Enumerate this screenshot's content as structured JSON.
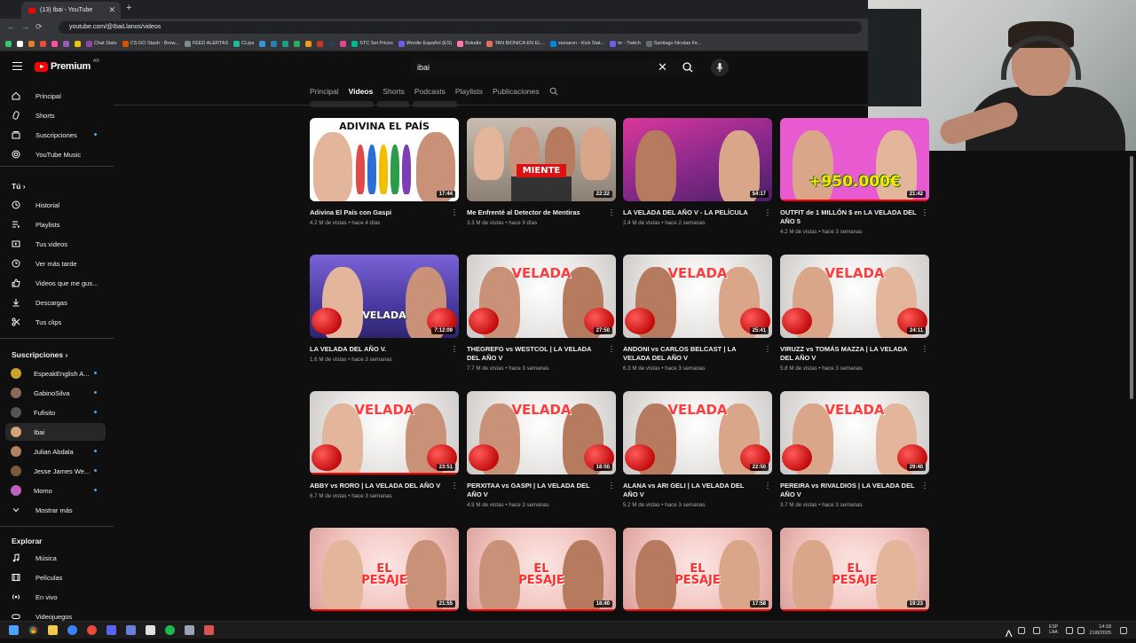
{
  "browser": {
    "tab_title": "(13) Ibai - YouTube",
    "url": "youtube.com/@IbaiLlanos/videos",
    "bookmarks": [
      "",
      "",
      "",
      "",
      "",
      "",
      "",
      "Chat Stats",
      "CS:GO Stash - Brow...",
      "FEED ALERTAS",
      "CLips",
      "",
      "",
      "",
      "",
      "",
      "",
      "",
      "",
      "STC Set Prices",
      "Wordle Español (ES)",
      "Boludle",
      "TAN BIONICA EN EL...",
      "sionaron - Kick Stat...",
      "trr - Twitch",
      "Santiago Nicolas Fe..."
    ]
  },
  "masthead": {
    "logo_text": "Premium",
    "country_code": "AR",
    "search_value": "ibai"
  },
  "sidebar": {
    "main": [
      {
        "label": "Principal",
        "icon": "home-icon"
      },
      {
        "label": "Shorts",
        "icon": "shorts-icon"
      },
      {
        "label": "Suscripciones",
        "icon": "subscriptions-icon"
      },
      {
        "label": "YouTube Music",
        "icon": "music-icon"
      }
    ],
    "you_heading": "Tú",
    "you": [
      {
        "label": "Historial",
        "icon": "history-icon"
      },
      {
        "label": "Playlists",
        "icon": "playlists-icon"
      },
      {
        "label": "Tus videos",
        "icon": "your-videos-icon"
      },
      {
        "label": "Ver más tarde",
        "icon": "watch-later-icon"
      },
      {
        "label": "Videos que me gus...",
        "icon": "like-icon"
      },
      {
        "label": "Descargas",
        "icon": "download-icon"
      },
      {
        "label": "Tus clips",
        "icon": "clips-icon"
      }
    ],
    "subs_heading": "Suscripciones",
    "subs": [
      {
        "label": "EspeakEnglish A...",
        "color": "#c9a227"
      },
      {
        "label": "GabinoSilva",
        "color": "#8b6b5a"
      },
      {
        "label": "Fufisito",
        "color": "#555555"
      },
      {
        "label": "Ibai",
        "color": "#d4a37a"
      },
      {
        "label": "Julian Abdala",
        "color": "#b08060"
      },
      {
        "label": "Jesse James We...",
        "color": "#7a5a3a"
      },
      {
        "label": "Momo",
        "color": "#c060c0"
      }
    ],
    "show_more": "Mostrar más",
    "explore_heading": "Explorar",
    "explore": [
      {
        "label": "Música",
        "icon": "music-note-icon"
      },
      {
        "label": "Películas",
        "icon": "film-icon"
      },
      {
        "label": "En vivo",
        "icon": "live-icon"
      },
      {
        "label": "Videojuegos",
        "icon": "gaming-icon"
      }
    ]
  },
  "channel_tabs": [
    "Principal",
    "Videos",
    "Shorts",
    "Podcasts",
    "Playlists",
    "Publicaciones"
  ],
  "active_tab": "Videos",
  "videos": [
    {
      "title": "Adivina El País con Gaspi",
      "views": "4.2 M de vistas",
      "age": "hace 4 días",
      "duration": "17:44",
      "caption": "ADIVINA EL PAÍS",
      "caption_color": "#ffffff",
      "bg": "#ffffff",
      "watched": 0.0
    },
    {
      "title": "Me Enfrenté al Detector de Mentiras",
      "views": "3.3 M de vistas",
      "age": "hace 9 días",
      "duration": "22:22",
      "caption": "MIENTE",
      "caption_color": "#ffffff",
      "bg": "#b7a89a",
      "watched": 0.0
    },
    {
      "title": "LA VELADA DEL AÑO V - LA PELÍCULA",
      "views": "2.4 M de vistas",
      "age": "hace 2 semanas",
      "duration": "54:17",
      "caption": "",
      "caption_color": "#ffffff",
      "bg": "#b0307a",
      "watched": 0.0
    },
    {
      "title": "OUTFIT de 1 MILLÓN $ en LA VELADA DEL AÑO 5",
      "views": "4.2 M de vistas",
      "age": "hace 3 semanas",
      "duration": "21:42",
      "caption": "+950.000€",
      "caption_color": "#ffe600",
      "bg": "#e85bd0",
      "watched": 1.0
    },
    {
      "title": "LA VELADA DEL AÑO V.",
      "views": "1.6 M de vistas",
      "age": "hace 3 semanas",
      "duration": "7:12:09",
      "caption": "VELADA",
      "caption_color": "#ffffff",
      "bg": "#6a4fc8",
      "watched": 0.0
    },
    {
      "title": "THEGREFG vs WESTCOL | LA VELADA DEL AÑO V",
      "views": "7.7 M de vistas",
      "age": "hace 3 semanas",
      "duration": "27:50",
      "caption": "VELADA",
      "caption_color": "#ff3b3b",
      "bg": "#e4e2e0",
      "watched": 0.0
    },
    {
      "title": "ANDONI vs CARLOS BELCAST | LA VELADA DEL AÑO V",
      "views": "6.3 M de vistas",
      "age": "hace 3 semanas",
      "duration": "25:41",
      "caption": "VELADA",
      "caption_color": "#ff3b3b",
      "bg": "#e4e2e0",
      "watched": 0.0
    },
    {
      "title": "VIRUZZ vs TOMÁS MAZZA | LA VELADA DEL AÑO V",
      "views": "5.8 M de vistas",
      "age": "hace 3 semanas",
      "duration": "24:11",
      "caption": "VELADA",
      "caption_color": "#ff3b3b",
      "bg": "#e4e2e0",
      "watched": 0.0
    },
    {
      "title": "ABBY vs RORO | LA VELADA DEL AÑO V",
      "views": "6.7 M de vistas",
      "age": "hace 3 semanas",
      "duration": "23:51",
      "caption": "VELADA",
      "caption_color": "#ff3b3b",
      "bg": "#e4e2e0",
      "watched": 1.0
    },
    {
      "title": "PERXITAA vs GASPI | LA VELADA DEL AÑO V",
      "views": "4.9 M de vistas",
      "age": "hace 3 semanas",
      "duration": "18:50",
      "caption": "VELADA",
      "caption_color": "#ff3b3b",
      "bg": "#e4e2e0",
      "watched": 0.0
    },
    {
      "title": "ALANA vs ARI GELI | LA VELADA DEL AÑO V",
      "views": "5.2 M de vistas",
      "age": "hace 3 semanas",
      "duration": "22:50",
      "caption": "VELADA",
      "caption_color": "#ff3b3b",
      "bg": "#e4e2e0",
      "watched": 0.0
    },
    {
      "title": "PEREIRA vs RIVALDIOS | LA VELADA DEL AÑO V",
      "views": "3.7 M de vistas",
      "age": "hace 3 semanas",
      "duration": "29:40",
      "caption": "VELADA",
      "caption_color": "#ff3b3b",
      "bg": "#e4e2e0",
      "watched": 0.0
    },
    {
      "title": "",
      "views": "",
      "age": "",
      "duration": "21:55",
      "caption": "EL PESAJE",
      "caption_color": "#ff2e2e",
      "bg": "#f0c9c6",
      "watched": 1.0
    },
    {
      "title": "",
      "views": "",
      "age": "",
      "duration": "18:40",
      "caption": "EL PESAJE",
      "caption_color": "#ff2e2e",
      "bg": "#f0c9c6",
      "watched": 1.0
    },
    {
      "title": "",
      "views": "",
      "age": "",
      "duration": "17:58",
      "caption": "EL PESAJE",
      "caption_color": "#ff2e2e",
      "bg": "#f0c9c6",
      "watched": 1.0
    },
    {
      "title": "",
      "views": "",
      "age": "",
      "duration": "19:23",
      "caption": "EL PESAJE",
      "caption_color": "#ff2e2e",
      "bg": "#f0c9c6",
      "watched": 1.0
    }
  ],
  "taskbar": {
    "lang_1": "ESP",
    "lang_2": "LAA",
    "time": "14:18",
    "date": "21/8/2025"
  },
  "colors": {
    "accent": "#ff0000",
    "new_dot": "#3ea6ff",
    "bg": "#0f0f0f"
  }
}
